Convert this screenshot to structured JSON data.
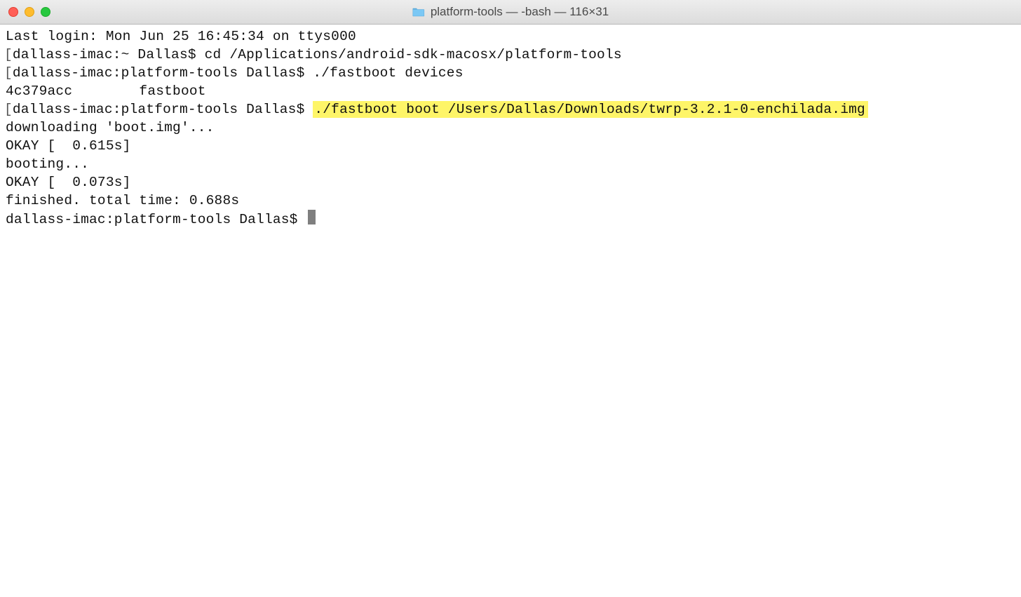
{
  "window": {
    "title": "platform-tools — -bash — 116×31",
    "traffic_lights": {
      "close": "close",
      "minimize": "minimize",
      "maximize": "maximize"
    }
  },
  "terminal": {
    "lines": [
      {
        "type": "plain",
        "text": "Last login: Mon Jun 25 16:45:34 on ttys000"
      },
      {
        "type": "bracket",
        "prompt": "dallass-imac:~ Dallas$ ",
        "cmd": "cd /Applications/android-sdk-macosx/platform-tools"
      },
      {
        "type": "bracket",
        "prompt": "dallass-imac:platform-tools Dallas$ ",
        "cmd": "./fastboot devices"
      },
      {
        "type": "plain",
        "text": "4c379acc        fastboot"
      },
      {
        "type": "bracket-hl",
        "prompt": "dallass-imac:platform-tools Dallas$ ",
        "cmd": "./fastboot boot /Users/Dallas/Downloads/twrp-3.2.1-0-enchilada.img"
      },
      {
        "type": "plain",
        "text": "downloading 'boot.img'..."
      },
      {
        "type": "plain",
        "text": "OKAY [  0.615s]"
      },
      {
        "type": "plain",
        "text": "booting..."
      },
      {
        "type": "plain",
        "text": "OKAY [  0.073s]"
      },
      {
        "type": "plain",
        "text": "finished. total time: 0.688s"
      },
      {
        "type": "prompt-cursor",
        "prompt": "dallass-imac:platform-tools Dallas$ "
      }
    ]
  }
}
